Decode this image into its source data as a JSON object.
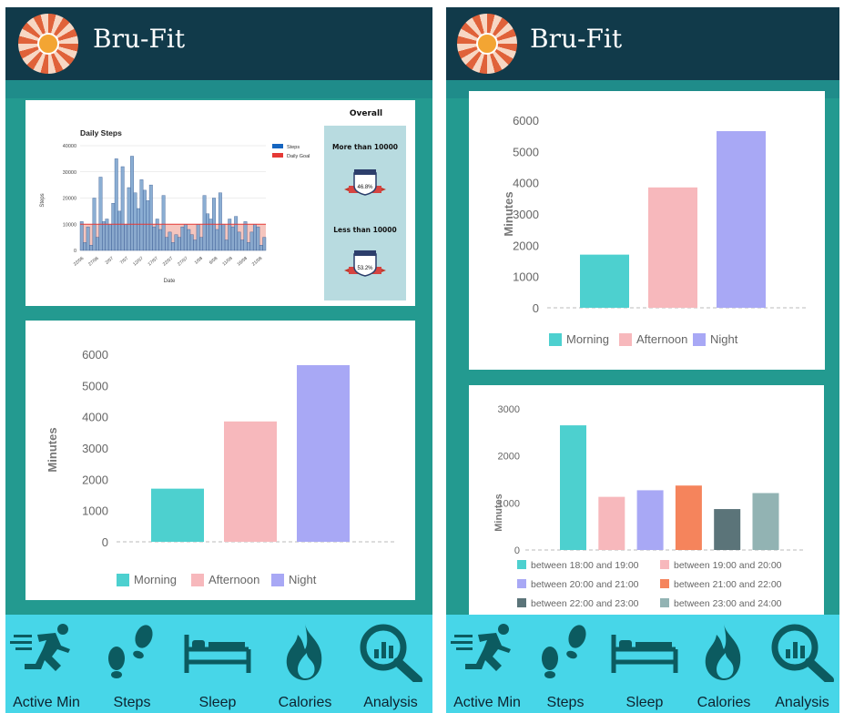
{
  "app": {
    "title": "Bru-Fit"
  },
  "colors": {
    "header": "#113a4a",
    "frame": "#239a90",
    "tabbar": "#47d6e8",
    "icon": "#0c5b60"
  },
  "tabs": [
    {
      "label": "Active Min",
      "icon": "running-person-icon"
    },
    {
      "label": "Steps",
      "icon": "footprints-icon"
    },
    {
      "label": "Sleep",
      "icon": "bed-icon"
    },
    {
      "label": "Calories",
      "icon": "flame-icon"
    },
    {
      "label": "Analysis",
      "icon": "magnifier-chart-icon"
    }
  ],
  "overall": {
    "title": "Overall",
    "more_label": "More than 10000",
    "more_value": "46.8%",
    "less_label": "Less than 10000",
    "less_value": "53.2%"
  },
  "chart_data": [
    {
      "type": "bar",
      "title": "Daily Steps",
      "xlabel": "Date",
      "ylabel": "Steps",
      "ylim": [
        0,
        40000
      ],
      "yticks": [
        "0",
        "10000",
        "20000",
        "30000",
        "40000"
      ],
      "xticks": [
        "22/06",
        "27/06",
        "2/07",
        "7/07",
        "12/07",
        "17/07",
        "22/07",
        "27/07",
        "1/08",
        "6/08",
        "11/08",
        "16/08",
        "21/08"
      ],
      "series": [
        {
          "name": "Steps",
          "color": "#1565c0",
          "values": [
            11000,
            3000,
            9000,
            2000,
            20000,
            5000,
            28000,
            11000,
            12000,
            10000,
            18000,
            35000,
            15000,
            32000,
            10000,
            24000,
            36000,
            22000,
            16000,
            27000,
            23000,
            19000,
            25000,
            9000,
            12000,
            8000,
            21000,
            5000,
            7000,
            3000,
            6000,
            5000,
            9000,
            10000,
            8000,
            6000,
            4000,
            10000,
            5000,
            21000,
            14000,
            12000,
            20000,
            8000,
            22000,
            10000,
            4000,
            12000,
            9000,
            13000,
            7000,
            4000,
            11000,
            3000,
            7000,
            10000,
            9000,
            2000,
            5000
          ]
        },
        {
          "name": "Daily Goal",
          "color": "#e53935",
          "values": [
            10000
          ]
        }
      ]
    },
    {
      "type": "bar",
      "xlabel": "",
      "ylabel": "Minutes",
      "ylim": [
        0,
        6000
      ],
      "yticks": [
        "0",
        "1000",
        "2000",
        "3000",
        "4000",
        "5000",
        "6000"
      ],
      "categories": [
        "Morning",
        "Afternoon",
        "Night"
      ],
      "values": [
        1700,
        3850,
        5650
      ],
      "colors": [
        "#4dd0cf",
        "#f7b8bc",
        "#a8a8f5"
      ]
    },
    {
      "type": "bar",
      "xlabel": "",
      "ylabel": "Minutes",
      "ylim": [
        0,
        6000
      ],
      "yticks": [
        "0",
        "1000",
        "2000",
        "3000",
        "4000",
        "5000",
        "6000"
      ],
      "categories": [
        "Morning",
        "Afternoon",
        "Night"
      ],
      "values": [
        1700,
        3850,
        5650
      ],
      "colors": [
        "#4dd0cf",
        "#f7b8bc",
        "#a8a8f5"
      ]
    },
    {
      "type": "bar",
      "xlabel": "",
      "ylabel": "Minutes",
      "ylim": [
        0,
        3000
      ],
      "yticks": [
        "0",
        "1000",
        "2000",
        "3000"
      ],
      "categories": [
        "between 18:00 and 19:00",
        "between 19:00 and 20:00",
        "between 20:00 and 21:00",
        "between 21:00 and 22:00",
        "between 22:00 and 23:00",
        "between 23:00 and 24:00"
      ],
      "values": [
        2650,
        1130,
        1270,
        1370,
        870,
        1210
      ],
      "colors": [
        "#4dd0cf",
        "#f7b8bc",
        "#a8a8f5",
        "#f5845c",
        "#5b7479",
        "#92b3b3"
      ]
    }
  ]
}
